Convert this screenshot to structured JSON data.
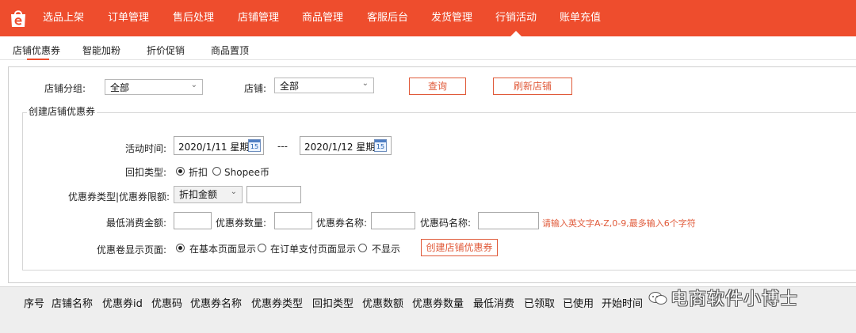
{
  "nav": {
    "items": [
      "选品上架",
      "订单管理",
      "售后处理",
      "店铺管理",
      "商品管理",
      "客服后台",
      "发货管理",
      "行销活动",
      "账单充值"
    ],
    "active": "行销活动"
  },
  "subtabs": [
    "店铺优惠券",
    "智能加粉",
    "折价促销",
    "商品置顶"
  ],
  "filter": {
    "group_label": "店铺分组:",
    "group_value": "全部",
    "shop_label": "店铺:",
    "shop_value": "全部",
    "query_button": "查询",
    "refresh_button": "刷新店铺"
  },
  "form": {
    "legend": "创建店铺优惠券",
    "time_label": "活动时间:",
    "start_date": "2020/1/11 星期",
    "end_date": "2020/1/12 星期",
    "date_sep": "---",
    "cal_day": "15",
    "rebate_label": "回扣类型:",
    "rebate_options": [
      "折扣",
      "Shopee币"
    ],
    "coupon_type_label": "优惠券类型|优惠券限额:",
    "coupon_type_value": "折扣金额",
    "min_spend_label": "最低消费金额:",
    "coupon_count_label": "优惠券数量:",
    "coupon_name_label": "优惠券名称:",
    "code_name_label": "优惠码名称:",
    "code_hint": "请输入英文字A-Z,0-9,最多输入6个字符",
    "display_label": "优惠卷显示页面:",
    "display_options": [
      "在基本页面显示",
      "在订单支付页面显示",
      "不显示"
    ],
    "create_button": "创建店铺优惠券"
  },
  "table": {
    "columns": [
      "序号",
      "店铺名称",
      "优惠券id",
      "优惠码",
      "优惠券名称",
      "优惠券类型",
      "回扣类型",
      "优惠数额",
      "优惠券数量",
      "最低消费",
      "已领取",
      "已使用",
      "开始时间"
    ]
  },
  "watermark": "电商软件小博士",
  "colors": {
    "brand": "#ee4d2d",
    "accent_red": "#e05a3a"
  }
}
